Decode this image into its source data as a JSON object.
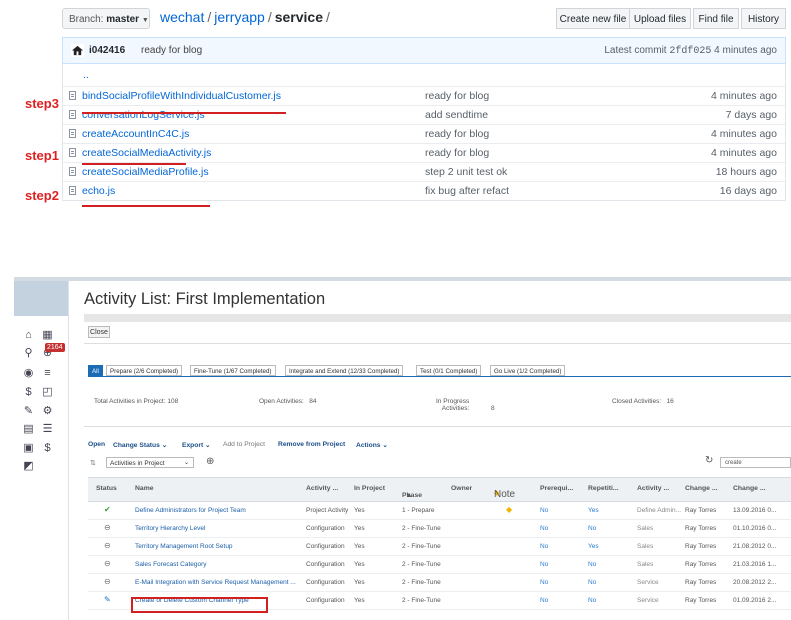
{
  "github": {
    "branch_label": "Branch:",
    "branch_value": "master",
    "breadcrumb": {
      "owner": "wechat",
      "repo": "jerryapp",
      "folder": "service",
      "sep": "/"
    },
    "buttons": {
      "create": "Create new file",
      "upload": "Upload files",
      "find": "Find file",
      "history": "History"
    },
    "commit": {
      "author": "i042416",
      "message": "ready for blog",
      "latest_prefix": "Latest commit",
      "sha": "2fdf025",
      "age": "4 minutes ago"
    },
    "parent_dir": "..",
    "files": [
      {
        "name": "bindSocialProfileWithIndividualCustomer.js",
        "message": "ready for blog",
        "age": "4 minutes ago"
      },
      {
        "name": "conversationLogService.js",
        "message": "add sendtime",
        "age": "7 days ago"
      },
      {
        "name": "createAccountInC4C.js",
        "message": "ready for blog",
        "age": "4 minutes ago"
      },
      {
        "name": "createSocialMediaActivity.js",
        "message": "ready for blog",
        "age": "4 minutes ago"
      },
      {
        "name": "createSocialMediaProfile.js",
        "message": "step 2 unit test ok",
        "age": "18 hours ago"
      },
      {
        "name": "echo.js",
        "message": "fix bug after refact",
        "age": "16 days ago"
      }
    ],
    "annotations": {
      "step1": "step1",
      "step2": "step2",
      "step3": "step3"
    }
  },
  "activity": {
    "title": "Activity List: First Implementation",
    "close": "Close",
    "badge": "2164",
    "tabs": [
      "All",
      "Prepare (2/6 Completed)",
      "Fine-Tune (1/67 Completed)",
      "Integrate and Extend (12/33 Completed)",
      "Test (0/1 Completed)",
      "Go Live (1/2 Completed)"
    ],
    "stats": {
      "total_label": "Total Activities in Project:",
      "total_value": "108",
      "open_label": "Open Activities:",
      "open_value": "84",
      "inprog_label_1": "In Progress",
      "inprog_label_2": "Activities:",
      "inprog_value": "8",
      "closed_label": "Closed Activities:",
      "closed_value": "16"
    },
    "toolbar": {
      "open": "Open",
      "change_status": "Change Status",
      "export": "Export",
      "add": "Add to Project",
      "remove": "Remove from Project",
      "actions": "Actions"
    },
    "view_select": "Activities in Project",
    "search_value": "create",
    "columns": {
      "status": "Status",
      "name": "Name",
      "activity": "Activity ...",
      "in_project": "In Project",
      "phase": "Phase",
      "owner": "Owner",
      "note": "Note",
      "prereq": "Prerequi...",
      "repet": "Repetiti...",
      "activity2": "Activity ...",
      "change1": "Change ...",
      "change2": "Change ..."
    },
    "rows": [
      {
        "status": "✔",
        "name": "Define Administrators for Project Team",
        "type": "Project Activity",
        "inproj": "Yes",
        "phase": "1 - Prepare",
        "note": "◆",
        "prereq": "No",
        "repet": "Yes",
        "act": "Define Admin...",
        "by": "Ray Torres",
        "date": "13.09.2016 0..."
      },
      {
        "status": "⊖",
        "name": "Territory Hierarchy Level",
        "type": "Configuration",
        "inproj": "Yes",
        "phase": "2 - Fine-Tune",
        "note": "",
        "prereq": "No",
        "repet": "No",
        "act": "Sales",
        "by": "Ray Torres",
        "date": "01.10.2016 0..."
      },
      {
        "status": "⊖",
        "name": "Territory Management Root Setup",
        "type": "Configuration",
        "inproj": "Yes",
        "phase": "2 - Fine-Tune",
        "note": "",
        "prereq": "No",
        "repet": "Yes",
        "act": "Sales",
        "by": "Ray Torres",
        "date": "21.08.2012 0..."
      },
      {
        "status": "⊖",
        "name": "Sales Forecast Category",
        "type": "Configuration",
        "inproj": "Yes",
        "phase": "2 - Fine-Tune",
        "note": "",
        "prereq": "No",
        "repet": "No",
        "act": "Sales",
        "by": "Ray Torres",
        "date": "21.03.2016 1..."
      },
      {
        "status": "⊖",
        "name": "E-Mail Integration with Service Request Management ...",
        "type": "Configuration",
        "inproj": "Yes",
        "phase": "2 - Fine-Tune",
        "note": "",
        "prereq": "No",
        "repet": "No",
        "act": "Service",
        "by": "Ray Torres",
        "date": "20.08.2012 2..."
      },
      {
        "status": "✎",
        "name": "Create or Delete Custom Channel Type",
        "type": "Configuration",
        "inproj": "Yes",
        "phase": "2 - Fine-Tune",
        "note": "",
        "prereq": "No",
        "repet": "No",
        "act": "Service",
        "by": "Ray Torres",
        "date": "01.09.2016 2..."
      }
    ]
  },
  "colors": {
    "link": "#0366d6",
    "annotation": "#d21f1f",
    "sap_blue": "#1c6bb5"
  },
  "icons": {
    "file": "file-icon",
    "avatar": "avatar-icon",
    "refresh": "refresh-icon",
    "zoom": "zoom-icon"
  }
}
